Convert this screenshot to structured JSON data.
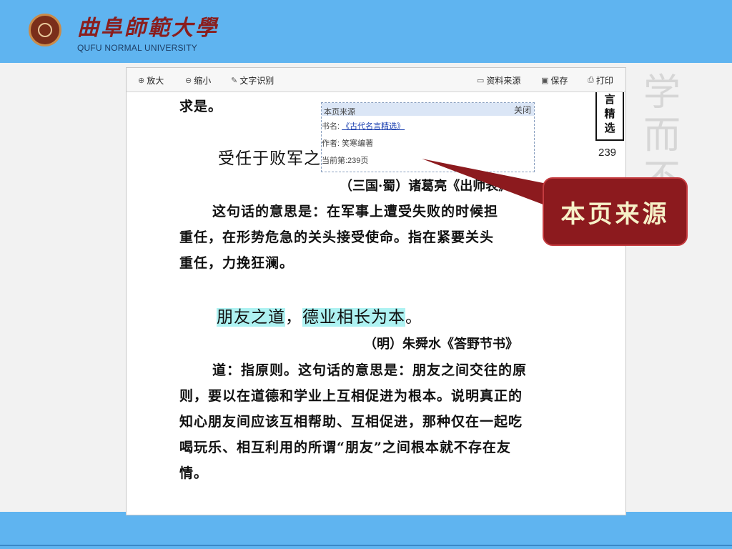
{
  "header": {
    "logo_cn": "曲阜師範大學",
    "logo_en": "QUFU NORMAL UNIVERSITY"
  },
  "background": {
    "chars": [
      "学",
      "而",
      "不"
    ]
  },
  "toolbar": {
    "zoom_in": "放大",
    "zoom_out": "缩小",
    "ocr": "文字识别",
    "source": "资料来源",
    "save": "保存",
    "print": "打印"
  },
  "page": {
    "line0": "求是。",
    "title1": "受任于败军之",
    "source1": "（三国·蜀）诸葛亮《出师表》",
    "para1": [
      "这句话的意思是：在军事上遭受失败的时候担",
      "重任，在形势危急的关头接受使命。指在紧要关头",
      "重任，力挽狂澜。"
    ],
    "title2_a": "朋友之道",
    "title2_sep": "，",
    "title2_b": "德业相长为本",
    "title2_end": "。",
    "source2": "（明）朱舜水《答野节书》",
    "para2": [
      "道：指原则。这句话的意思是：朋友之间交往的原",
      "则，要以在道德和学业上互相促进为根本。说明真正的",
      "知心朋友间应该互相帮助、互相促进，那种仅在一起吃",
      "喝玩乐、相互利用的所谓“朋友”之间根本就不存在友",
      "情。"
    ],
    "margin_chars": [
      "言",
      "精",
      "选"
    ],
    "page_number": "239"
  },
  "popup": {
    "title": "本页来源",
    "close": "关闭",
    "book_label": "书名:",
    "book_title": "《古代名言精选》",
    "author": "作者: 笑寒编著",
    "current_page": "当前第:239页"
  },
  "callout": {
    "label": "本页来源"
  },
  "colors": {
    "header_blue": "#5fb4f0",
    "callout_red": "#8c1a1e",
    "highlight": "#aef2f2"
  }
}
